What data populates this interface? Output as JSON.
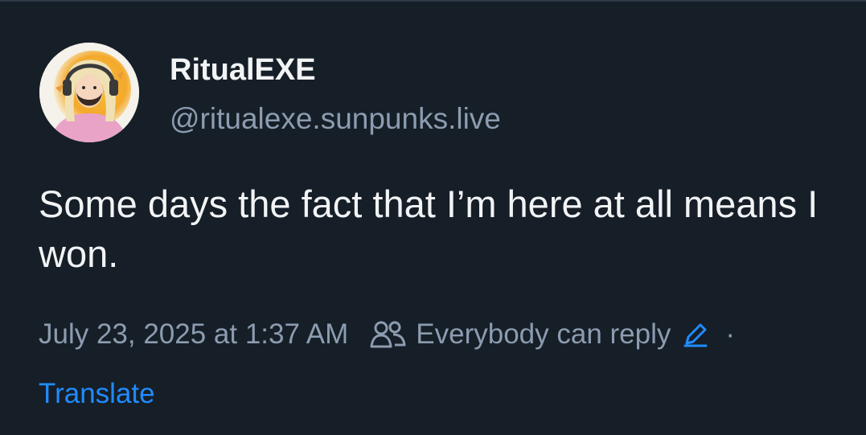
{
  "post": {
    "author": {
      "display_name": "RitualEXE",
      "handle": "@ritualexe.sunpunks.live",
      "avatar": "avatar-illustration"
    },
    "text": "Some days the fact that I’m here at all means I won.",
    "timestamp": "July 23, 2025 at 1:37 AM",
    "reply_setting": {
      "icon": "people-icon",
      "label": "Everybody can reply",
      "edit_icon": "pencil-icon"
    },
    "separator": "·",
    "translate_label": "Translate"
  },
  "colors": {
    "background": "#161e27",
    "text_primary": "#f1f3f5",
    "text_secondary": "#8c9cb0",
    "link": "#208bfe"
  }
}
